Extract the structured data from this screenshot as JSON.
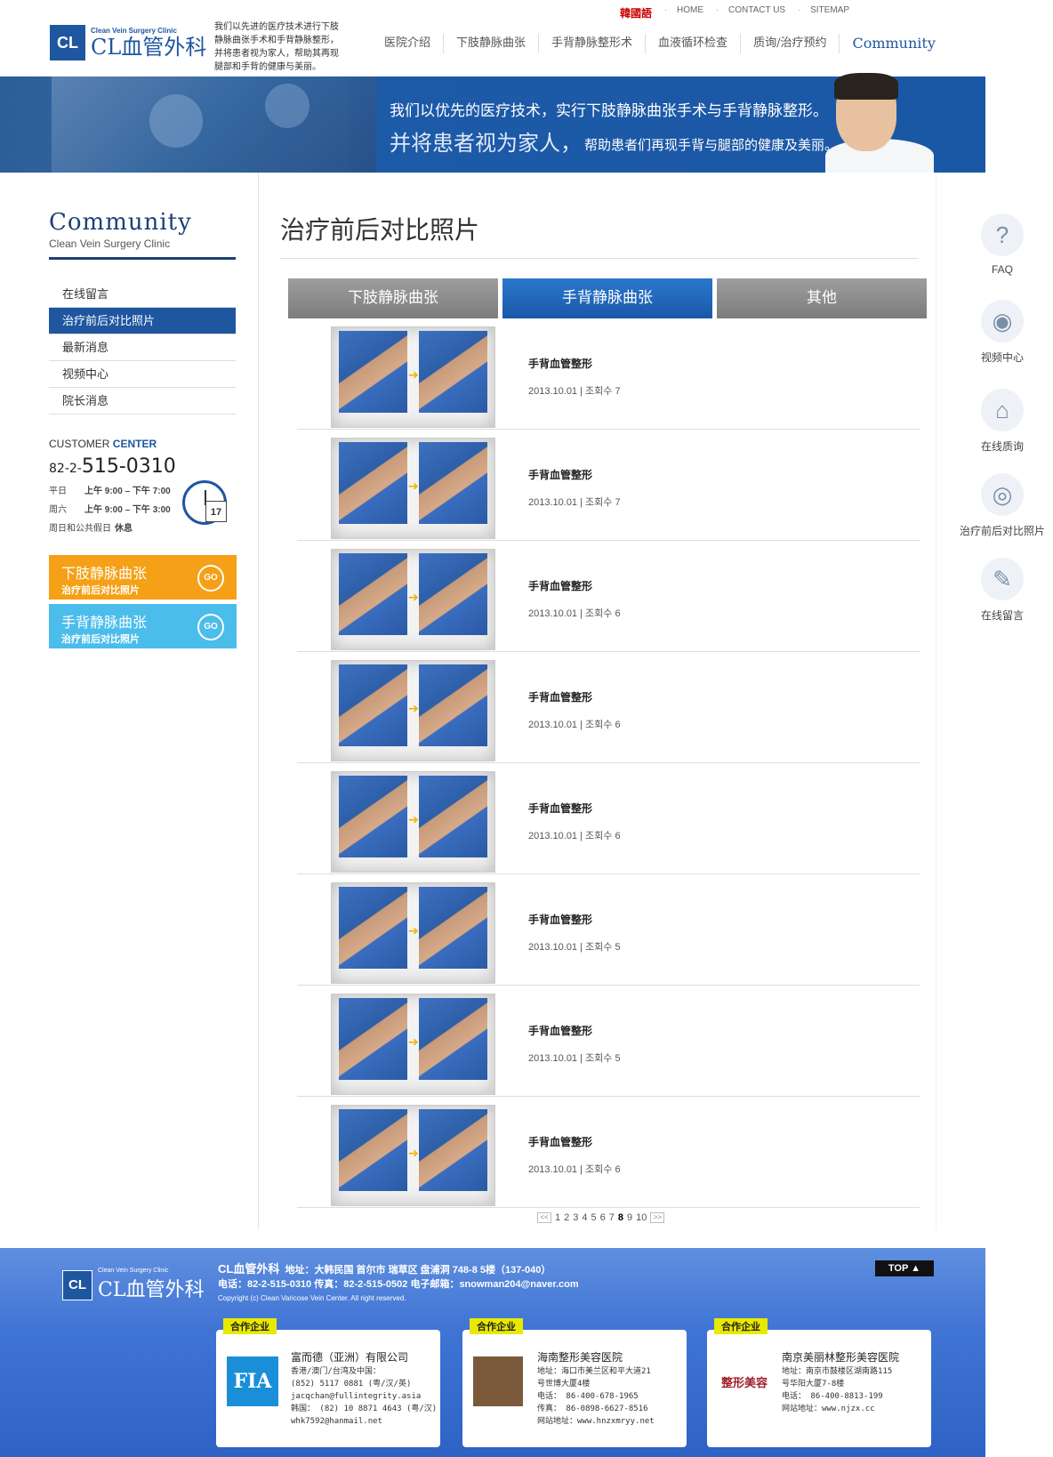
{
  "header": {
    "top_links": [
      "韓國語",
      "HOME",
      "CONTACT US",
      "SITEMAP"
    ],
    "logo_sub": "Clean Vein Surgery Clinic",
    "logo_main": "CL血管外科",
    "logo_box": "CL",
    "slogan": "我们以先进的医疗技术进行下肢静脉曲张手术和手背静脉整形，并将患者视为家人，帮助其再现腿部和手背的健康与美丽。",
    "nav": [
      "医院介绍",
      "下肢静脉曲张",
      "手背静脉整形术",
      "血液循环检查",
      "质询/治疗预约",
      "Community"
    ]
  },
  "banner": {
    "line1": "我们以优先的医疗技术，实行下肢静脉曲张手术与手背静脉整形。",
    "line2": "并将患者视为家人，",
    "line3": "帮助患者们再现手背与腿部的健康及美丽。"
  },
  "sidebar": {
    "title": "Community",
    "subtitle": "Clean Vein Surgery Clinic",
    "menu": [
      "在线留言",
      "治疗前后对比照片",
      "最新消息",
      "视频中心",
      "院长消息"
    ],
    "customer_center": {
      "label_a": "CUSTOMER ",
      "label_b": "CENTER",
      "phone_prefix": "82-2-",
      "phone": "515-0310",
      "rows": [
        {
          "day": "平日",
          "time": "上午 9:00 – 下午 7:00"
        },
        {
          "day": "周六",
          "time": "上午 9:00 – 下午 3:00"
        },
        {
          "day": "周日和公共假日",
          "time": "休息"
        }
      ],
      "calendar_day": "17"
    },
    "banners": [
      {
        "title": "下肢静脉曲张",
        "sub": "治疗前后对比照片",
        "go": "GO"
      },
      {
        "title": "手背静脉曲张",
        "sub": "治疗前后对比照片",
        "go": "GO"
      }
    ]
  },
  "main": {
    "page_title": "治疗前后对比照片",
    "tabs": [
      "下肢静脉曲张",
      "手背静脉曲张",
      "其他"
    ],
    "active_tab": 1,
    "items": [
      {
        "title": "手背血管整形",
        "meta": "2013.10.01 | 조회수 7"
      },
      {
        "title": "手背血管整形",
        "meta": "2013.10.01 | 조회수 7"
      },
      {
        "title": "手背血管整形",
        "meta": "2013.10.01 | 조회수 6"
      },
      {
        "title": "手背血管整形",
        "meta": "2013.10.01 | 조회수 6"
      },
      {
        "title": "手背血管整形",
        "meta": "2013.10.01 | 조회수 6"
      },
      {
        "title": "手背血管整形",
        "meta": "2013.10.01 | 조회수 5"
      },
      {
        "title": "手背血管整形",
        "meta": "2013.10.01 | 조회수 5"
      },
      {
        "title": "手背血管整形",
        "meta": "2013.10.01 | 조회수 6"
      }
    ],
    "pagination": {
      "pages": [
        "1",
        "2",
        "3",
        "4",
        "5",
        "6",
        "7",
        "8",
        "9",
        "10"
      ],
      "current": "8",
      "prev": "<<",
      "next": ">>"
    }
  },
  "quick_menu": [
    {
      "label": "FAQ",
      "icon": "question-icon"
    },
    {
      "label": "视频中心",
      "icon": "video-camera-icon"
    },
    {
      "label": "在线质询",
      "icon": "house-icon"
    },
    {
      "label": "治疗前后对比照片",
      "icon": "camera-icon"
    },
    {
      "label": "在线留言",
      "icon": "pen-note-icon"
    }
  ],
  "footer": {
    "logo_sub": "Clean Vein Surgery Clinic",
    "logo_main": "CL血管外科",
    "logo_box": "CL",
    "name": "CL血管外科",
    "address": "地址：大韩民国 首尔市 瑞草区 盘浦洞 748-8 5楼（137-040）",
    "contact": "电话：82-2-515-0310   传真：82-2-515-0502   电子邮箱：snowman204@naver.com",
    "copyright": "Copyright (c) Clean Varicose Vein Center. All right reserved.",
    "top_label": "TOP ▲",
    "partners": [
      {
        "tag": "合作企业",
        "logo": "FIA",
        "name": "富而德（亚洲）有限公司",
        "details": "香港/澳门/台湾及中国：\n(852) 5117 0881 (粤/汉/英)\njacqchan@fullintegrity.asia\n韩国： (82) 10 8871 4643 (粤/汉)\nwhk7592@hanmail.net"
      },
      {
        "tag": "合作企业",
        "logo": "",
        "name": "海南整形美容医院",
        "details": "地址：海口市美兰区和平大道21\n号世博大厦4楼\n电话： 86-400-678-1965\n传真： 86-0898-6627-8516\n网站地址：www.hnzxmryy.net"
      },
      {
        "tag": "合作企业",
        "logo": "整形美容",
        "name": "南京美丽林整形美容医院",
        "details": "地址：南京市鼓楼区湖南路115\n号华阳大厦7-8楼\n电话： 86-400-8813-199\n网站地址：www.njzx.cc"
      }
    ]
  }
}
